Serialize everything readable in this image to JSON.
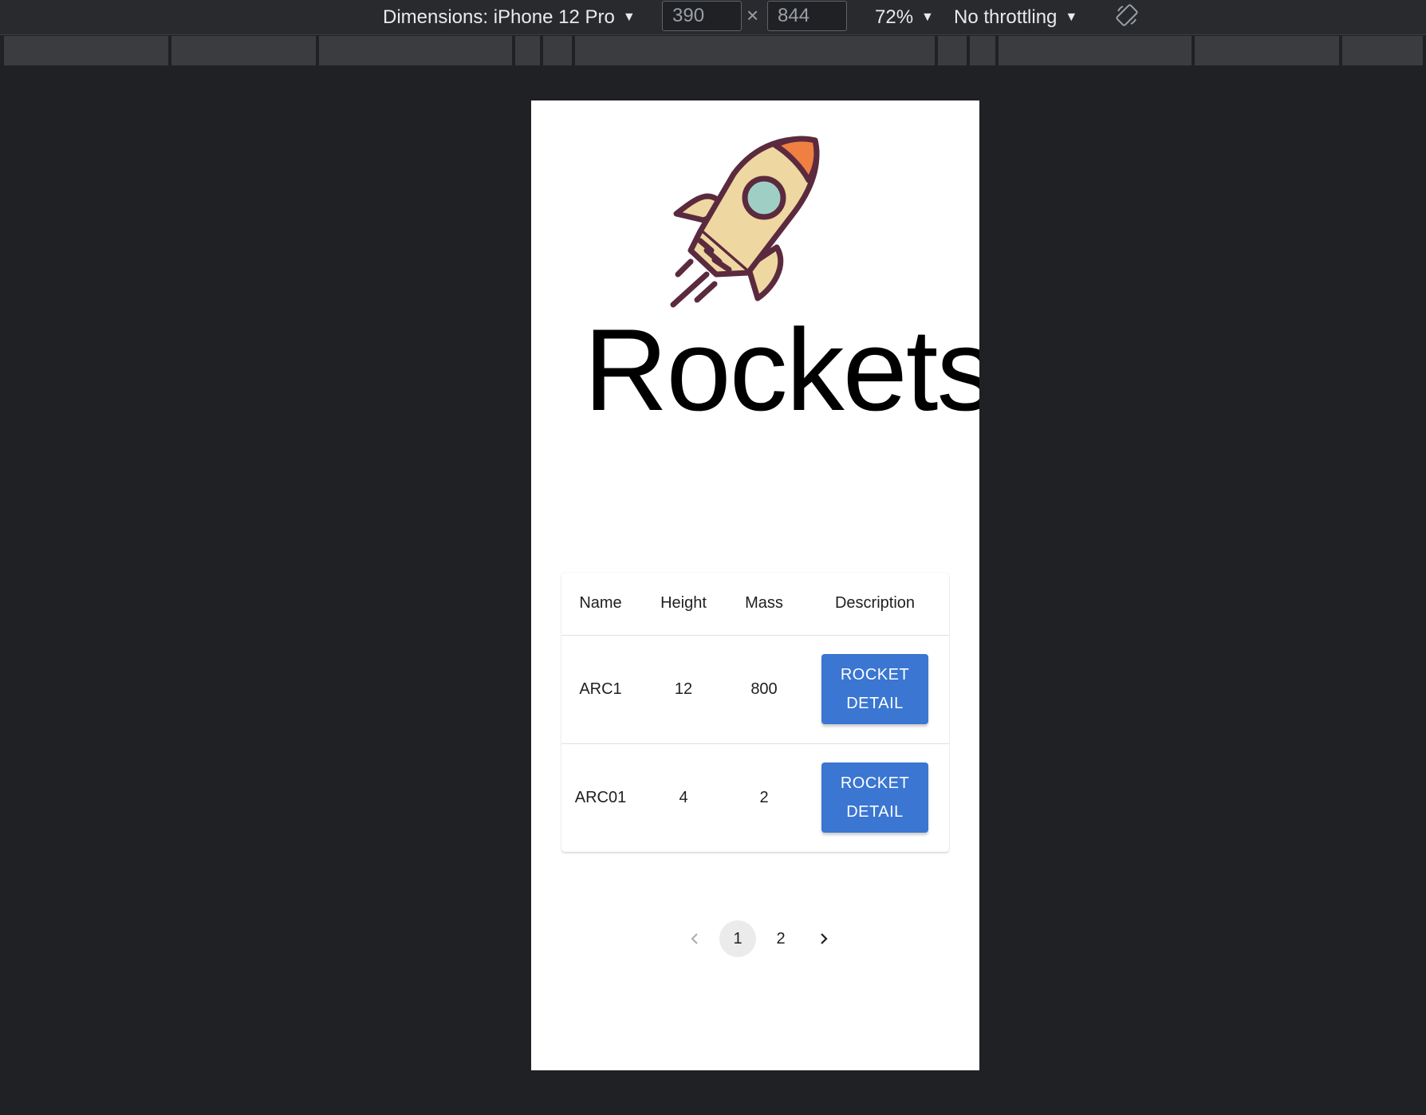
{
  "devtools": {
    "dimensions_label": "Dimensions: iPhone 12 Pro",
    "width_value": "390",
    "height_value": "844",
    "times": "×",
    "zoom": "72%",
    "throttling": "No throttling",
    "caret": "▼",
    "rotate_icon": "rotate-icon"
  },
  "page": {
    "logo_icon": "rocket-icon",
    "title": "Rockets"
  },
  "table": {
    "headers": [
      "Name",
      "Height",
      "Mass",
      "Description"
    ],
    "rows": [
      {
        "name": "ARC1",
        "height": "12",
        "mass": "800",
        "button_line1": "ROCKET",
        "button_line2": "DETAIL"
      },
      {
        "name": "ARC01",
        "height": "4",
        "mass": "2",
        "button_line1": "ROCKET",
        "button_line2": "DETAIL"
      }
    ]
  },
  "pagination": {
    "prev_icon": "chevron-left-icon",
    "pages": [
      "1",
      "2"
    ],
    "current": "1",
    "next_icon": "chevron-right-icon"
  },
  "colors": {
    "button": "#3a76d2",
    "rocket_outline": "#5b2a3e",
    "rocket_body": "#eed7a1",
    "rocket_tip": "#f07f42",
    "rocket_window": "#9fcfc4"
  }
}
